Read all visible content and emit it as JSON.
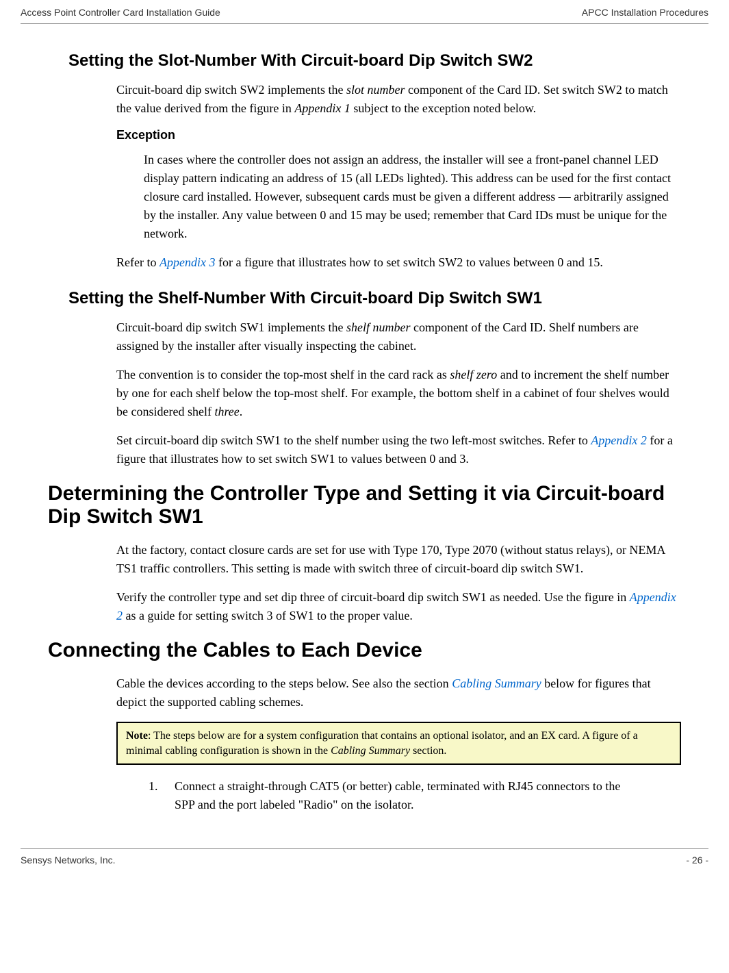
{
  "header": {
    "left": "Access Point Controller Card Installation Guide",
    "right": "APCC Installation Procedures"
  },
  "section1": {
    "heading": "Setting the Slot-Number With Circuit-board Dip Switch SW2",
    "p1_a": "Circuit-board dip switch SW2 implements the ",
    "p1_i1": "slot number",
    "p1_b": " component of the Card ID. Set switch SW2 to match the value derived from the figure in ",
    "p1_i2": "Appendix 1",
    "p1_c": " subject to the exception noted below.",
    "exception_heading": "Exception",
    "exception_text": "In cases where the controller does not assign an address, the installer will see a front-panel channel LED display pattern indicating an address of 15 (all LEDs lighted). This address can be used for the first contact closure card installed. However, subsequent cards must be given a different address — arbitrarily assigned by the installer. Any value between 0 and 15 may be used; remember that Card IDs must be unique for the network.",
    "p2_a": "Refer to ",
    "p2_link": "Appendix 3",
    "p2_b": " for a figure that illustrates how to set switch SW2 to values between 0 and 15."
  },
  "section2": {
    "heading": "Setting the Shelf-Number With Circuit-board Dip Switch SW1",
    "p1_a": "Circuit-board dip switch SW1 implements the ",
    "p1_i1": "shelf number",
    "p1_b": " component of the Card ID. Shelf numbers are assigned by the installer after visually inspecting the cabinet.",
    "p2_a": "The convention is to consider the top-most shelf in the card rack as ",
    "p2_i1": "shelf zero",
    "p2_b": " and to increment the shelf number by one for each shelf below the top-most shelf. For example, the bottom shelf in a cabinet of four shelves would be considered shelf ",
    "p2_i2": "three",
    "p2_c": ".",
    "p3_a": "Set circuit-board dip switch SW1 to the shelf number using the two left-most switches. Refer to ",
    "p3_link": "Appendix 2",
    "p3_b": " for a figure that illustrates how to set switch SW1 to values between 0 and 3."
  },
  "section3": {
    "heading": "Determining the Controller Type and Setting it via Circuit-board Dip Switch SW1",
    "p1": "At the factory, contact closure cards are set for use with Type 170, Type 2070 (without status relays), or NEMA TS1 traffic controllers. This setting is made with switch three of circuit-board dip switch SW1.",
    "p2_a": "Verify the controller type and set dip three of circuit-board dip switch SW1 as needed. Use the figure in ",
    "p2_link": "Appendix 2",
    "p2_b": " as a guide for setting switch 3 of SW1 to the proper value."
  },
  "section4": {
    "heading": "Connecting the Cables to Each Device",
    "p1_a": "Cable the devices according to the steps below. See also the section ",
    "p1_link": "Cabling Summary",
    "p1_b": " below for figures that depict the supported cabling schemes.",
    "note_bold": "Note",
    "note_a": ": The steps below are for a system configuration that contains an optional isolator, and an EX card. A figure of a minimal cabling configuration is shown in the ",
    "note_i": "Cabling Summary",
    "note_b": " section.",
    "li1": "Connect a straight-through CAT5 (or better) cable, terminated with RJ45 connectors to the SPP and the port labeled \"Radio\" on the isolator."
  },
  "footer": {
    "left": "Sensys Networks, Inc.",
    "right": "- 26 -"
  }
}
